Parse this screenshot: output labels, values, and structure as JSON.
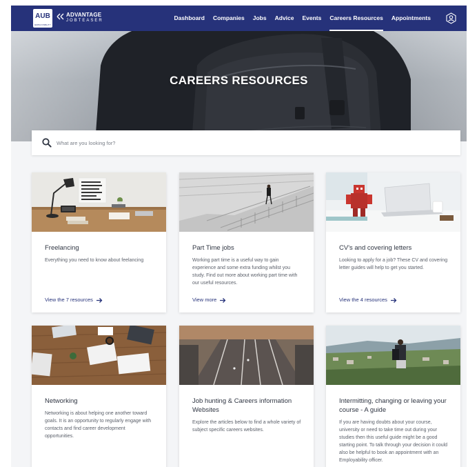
{
  "nav": {
    "logo_text": "AUB",
    "logo_sub": "EMPLOYABILITY",
    "brand_name": "ADVANTAGE",
    "brand_sub": "JOBTEASER",
    "links": [
      "Dashboard",
      "Companies",
      "Jobs",
      "Advice",
      "Events",
      "Careers Resources",
      "Appointments"
    ],
    "active": "Careers Resources",
    "icons": {
      "user": "user-circle-icon",
      "brand": "arrows-icon"
    },
    "colors": {
      "nav_bg": "#26327a",
      "link_color": "#26327a"
    }
  },
  "hero": {
    "title": "CAREERS RESOURCES"
  },
  "search": {
    "placeholder": "What are you looking for?",
    "value": "",
    "icon": "search-icon"
  },
  "cards": [
    {
      "title": "Freelancing",
      "description": "Everything you need to know about feelancing",
      "link": "View the 7 resources",
      "image": "desk-with-lamp"
    },
    {
      "title": "Part Time jobs",
      "description": "Working part time is a useful way to gain experience and some extra funding whilst you study. Find out more about working part time with our useful resources.",
      "link": "View more",
      "image": "woman-on-stairs"
    },
    {
      "title": "CV's and covering letters",
      "description": "Looking to apply for a job? These CV and covering letter guides will help to get you started.",
      "link": "View the 4 resources",
      "image": "robot-and-laptop"
    },
    {
      "title": "Networking",
      "description": "Networking is about helping one another toward goals. It is an opportunity to regularly engage with contacts and find career development opportunities.",
      "link": "",
      "image": "meeting-table"
    },
    {
      "title": "Job hunting & Careers information Websites",
      "description": "Explore the articles below to find a whole variety of subject specific careers websites.",
      "link": "",
      "image": "escalators"
    },
    {
      "title": "Intermitting, changing or leaving your course - A guide",
      "description": "If you are having doubts about your course, university or need to take time out during your studies then this useful guide might be a good starting point. To talk through your decision it could also be helpful to book an appointment with an Employability officer.",
      "link": "",
      "image": "hiker-viewpoint"
    }
  ]
}
